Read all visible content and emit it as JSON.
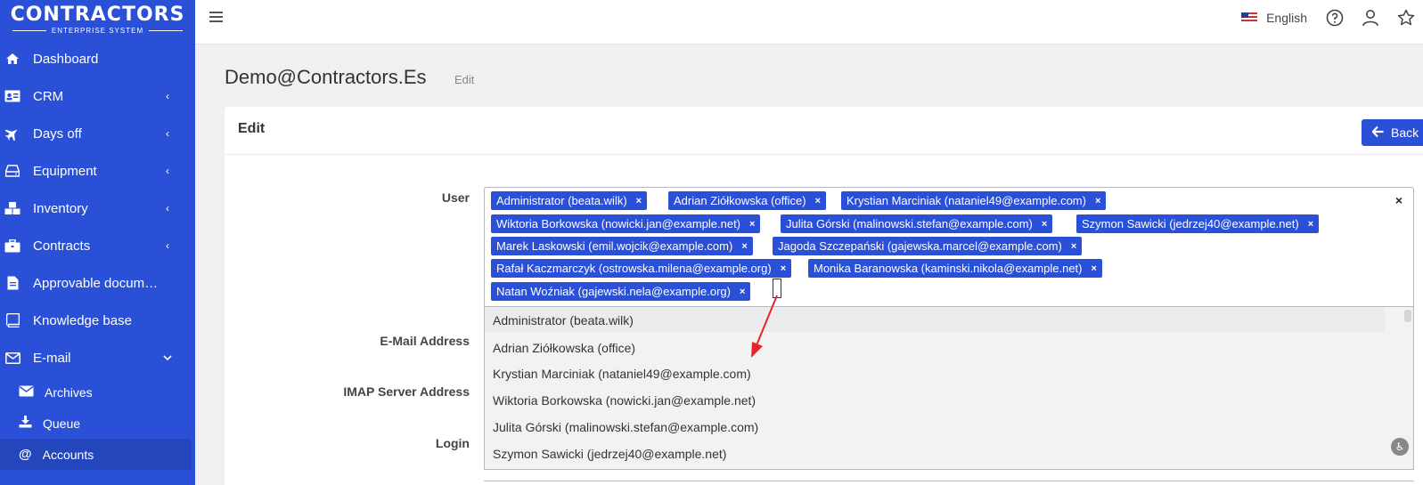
{
  "brand": {
    "name": "CONTRACTORS",
    "subtitle": "ENTERPRISE SYSTEM"
  },
  "sidebar": {
    "items": [
      {
        "label": "Dashboard",
        "icon": "home-icon",
        "chevron": ""
      },
      {
        "label": "CRM",
        "icon": "id-card-icon",
        "chevron": "‹"
      },
      {
        "label": "Days off",
        "icon": "plane-icon",
        "chevron": "‹"
      },
      {
        "label": "Equipment",
        "icon": "hdd-icon",
        "chevron": "‹"
      },
      {
        "label": "Inventory",
        "icon": "boxes-icon",
        "chevron": "‹"
      },
      {
        "label": "Contracts",
        "icon": "briefcase-icon",
        "chevron": "‹"
      },
      {
        "label": "Approvable documents",
        "icon": "file-icon",
        "chevron": ""
      },
      {
        "label": "Knowledge base",
        "icon": "book-icon",
        "chevron": ""
      },
      {
        "label": "E-mail",
        "icon": "envelope-icon",
        "chevron": "⌄"
      }
    ],
    "subitems": [
      {
        "label": "Archives",
        "icon": "envelope-solid-icon"
      },
      {
        "label": "Queue",
        "icon": "download-icon"
      },
      {
        "label": "Accounts",
        "icon": "at-icon"
      }
    ]
  },
  "topbar": {
    "language": "English"
  },
  "page": {
    "title": "Demo@Contractors.Es",
    "subtitle": "Edit"
  },
  "card": {
    "title": "Edit",
    "back_label": "Back"
  },
  "form": {
    "labels": {
      "user": "User",
      "email": "E-Mail Address",
      "imap": "IMAP Server Address",
      "login": "Login"
    },
    "selected_users": [
      "Administrator (beata.wilk)",
      "Adrian Ziółkowska (office)",
      "Krystian Marciniak (nataniel49@example.com)",
      "Wiktoria Borkowska (nowicki.jan@example.net)",
      "Julita Górski (malinowski.stefan@example.com)",
      "Szymon Sawicki (jedrzej40@example.net)",
      "Marek Laskowski (emil.wojcik@example.com)",
      "Jagoda Szczepański (gajewska.marcel@example.com)",
      "Rafał Kaczmarczyk (ostrowska.milena@example.org)",
      "Monika Baranowska (kaminski.nikola@example.net)",
      "Natan Woźniak (gajewski.nela@example.org)"
    ],
    "tag_remove": "×",
    "clear_all": "×",
    "dropdown_options": [
      "Administrator (beata.wilk)",
      "Adrian Ziółkowska (office)",
      "Krystian Marciniak (nataniel49@example.com)",
      "Wiktoria Borkowska (nowicki.jan@example.net)",
      "Julita Górski (malinowski.stefan@example.com)",
      "Szymon Sawicki (jedrzej40@example.net)"
    ]
  },
  "colors": {
    "brand": "#2a50d8",
    "annotation_arrow": "#e8232a"
  }
}
